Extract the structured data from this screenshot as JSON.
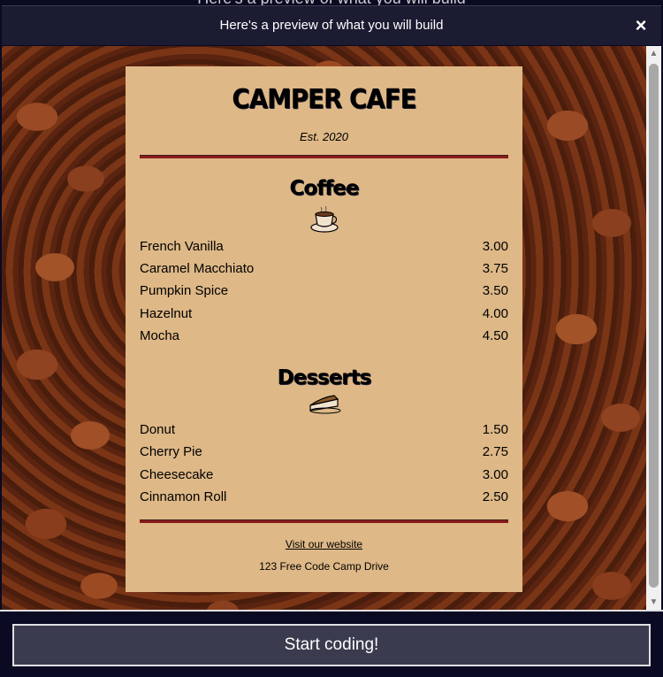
{
  "modal": {
    "background_title": "Here's a preview of what you will build",
    "title": "Here's a preview of what you will build",
    "close_glyph": "×"
  },
  "menu": {
    "title": "CAMPER CAFE",
    "established": "Est. 2020",
    "sections": [
      {
        "title": "Coffee",
        "icon": "coffee-cup-icon",
        "items": [
          {
            "name": "French Vanilla",
            "price": "3.00"
          },
          {
            "name": "Caramel Macchiato",
            "price": "3.75"
          },
          {
            "name": "Pumpkin Spice",
            "price": "3.50"
          },
          {
            "name": "Hazelnut",
            "price": "4.00"
          },
          {
            "name": "Mocha",
            "price": "4.50"
          }
        ]
      },
      {
        "title": "Desserts",
        "icon": "pie-slice-icon",
        "items": [
          {
            "name": "Donut",
            "price": "1.50"
          },
          {
            "name": "Cherry Pie",
            "price": "2.75"
          },
          {
            "name": "Cheesecake",
            "price": "3.00"
          },
          {
            "name": "Cinnamon Roll",
            "price": "2.50"
          }
        ]
      }
    ],
    "footer": {
      "link_text": "Visit our website",
      "address": "123 Free Code Camp Drive"
    }
  },
  "actions": {
    "start_label": "Start coding!"
  },
  "colors": {
    "menu_background": "#deb887",
    "divider": "#8b1a1a",
    "modal_background": "#0a0a23",
    "button_background": "#3b3b4f"
  }
}
